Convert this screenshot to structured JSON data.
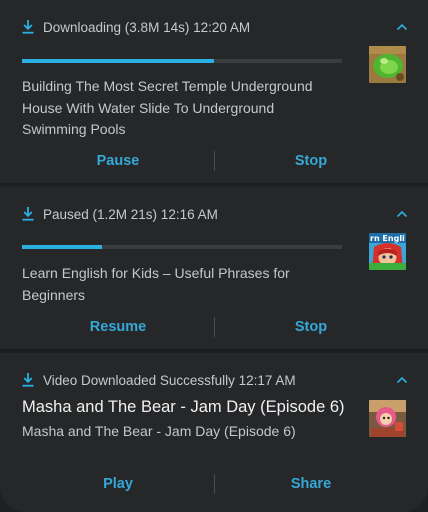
{
  "notifications": [
    {
      "status": "Downloading (3.8M 14s) 12:20 AM",
      "progress_percent": 60,
      "title": "Building The Most Secret Temple Underground House With Water Slide To Underground Swimming Pools",
      "actions": {
        "left": "Pause",
        "right": "Stop"
      },
      "thumbnail": "green-slime-thumbnail"
    },
    {
      "status": "Paused (1.2M 21s) 12:16 AM",
      "progress_percent": 25,
      "title": "Learn English for Kids – Useful Phrases for Beginners",
      "thumbnail_text": "rn Engli",
      "actions": {
        "left": "Resume",
        "right": "Stop"
      },
      "thumbnail": "cartoon-girl-thumbnail"
    },
    {
      "status": "Video Downloaded Successfully 12:17 AM",
      "title": "Masha and The Bear - Jam Day (Episode 6)",
      "subtitle": "Masha and The Bear - Jam Day (Episode 6)",
      "actions": {
        "left": "Play",
        "right": "Share"
      },
      "thumbnail": "masha-thumbnail"
    }
  ],
  "colors": {
    "accent": "#35a8d8",
    "progress": "#2bb0e3",
    "card_bg": "#262729",
    "text_primary": "#f1f1f1",
    "text_secondary": "#c6c7c9"
  }
}
